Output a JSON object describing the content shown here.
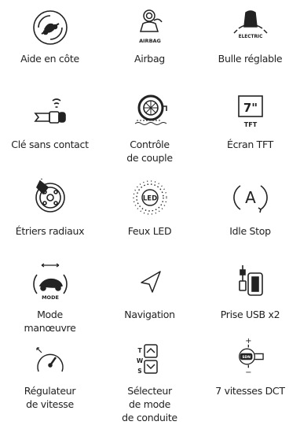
{
  "features": [
    {
      "label": "Aide en côte",
      "icon": "hill-assist-icon"
    },
    {
      "label": "Airbag",
      "icon": "airbag-icon",
      "icon_text": "AIRBAG"
    },
    {
      "label": "Bulle réglable",
      "icon": "adjustable-windscreen-icon",
      "icon_text": "ELECTRIC"
    },
    {
      "label": "Clé sans contact",
      "icon": "keyless-key-icon"
    },
    {
      "label": "Contrôle\nde couple",
      "icon": "traction-control-icon"
    },
    {
      "label": "Écran TFT",
      "icon": "tft-screen-icon",
      "icon_text": "7\"",
      "icon_subtext": "TFT"
    },
    {
      "label": "Étriers radiaux",
      "icon": "radial-brake-caliper-icon"
    },
    {
      "label": "Feux LED",
      "icon": "led-lights-icon",
      "icon_text": "LED"
    },
    {
      "label": "Idle Stop",
      "icon": "idle-stop-icon",
      "icon_text": "A"
    },
    {
      "label": "Mode\nmanœuvre",
      "icon": "maneuver-mode-icon",
      "icon_text": "MODE"
    },
    {
      "label": "Navigation",
      "icon": "navigation-arrow-icon"
    },
    {
      "label": "Prise USB x2",
      "icon": "usb-socket-icon"
    },
    {
      "label": "Régulateur\nde vitesse",
      "icon": "cruise-control-icon"
    },
    {
      "label": "Sélecteur\nde mode\nde conduite",
      "icon": "riding-mode-selector-icon",
      "icon_text": [
        "T",
        "W",
        "S"
      ]
    },
    {
      "label": "7 vitesses DCT",
      "icon": "dct-gearbox-icon",
      "icon_text": "SDN",
      "icon_plus": "+",
      "icon_minus": "−"
    }
  ]
}
